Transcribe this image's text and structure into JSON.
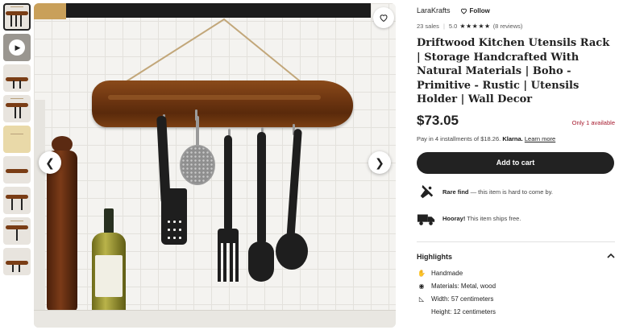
{
  "product": {
    "title": "Driftwood Kitchen Utensils Rack | Storage Handcrafted With Natural Materials | Boho - Primitive - Rustic | Utensils Holder | Wall Decor",
    "price": "$73.05",
    "stock_note": "Only 1 available",
    "installments": {
      "text": "Pay in 4 installments of $18.26.",
      "provider": "Klarna.",
      "link": "Learn more"
    },
    "add_to_cart_label": "Add to cart"
  },
  "shop": {
    "name": "LaraKrafts",
    "follow_label": "Follow",
    "sales": "23 sales",
    "rating": "5.0",
    "stars": "★★★★★",
    "reviews": "(8 reviews)"
  },
  "notices": [
    {
      "icon": "rare-find-icon",
      "title": "Rare find",
      "text": " — this item is hard to come by."
    },
    {
      "icon": "delivery-truck-icon",
      "title": "Hooray!",
      "text": " This item ships free."
    }
  ],
  "highlights": {
    "heading": "Highlights",
    "items": [
      {
        "icon": "handmade-icon",
        "text": "Handmade"
      },
      {
        "icon": "materials-icon",
        "text": "Materials: Metal, wood"
      },
      {
        "icon": "ruler-icon",
        "text": "Width: 57 centimeters"
      },
      {
        "icon": "",
        "text": "Height: 12 centimeters"
      }
    ]
  },
  "gallery": {
    "thumbnail_count": 9,
    "active_index": 0,
    "video_index": 1
  },
  "colors": {
    "price_alert": "#a61a2e",
    "button_dark": "#222222"
  }
}
